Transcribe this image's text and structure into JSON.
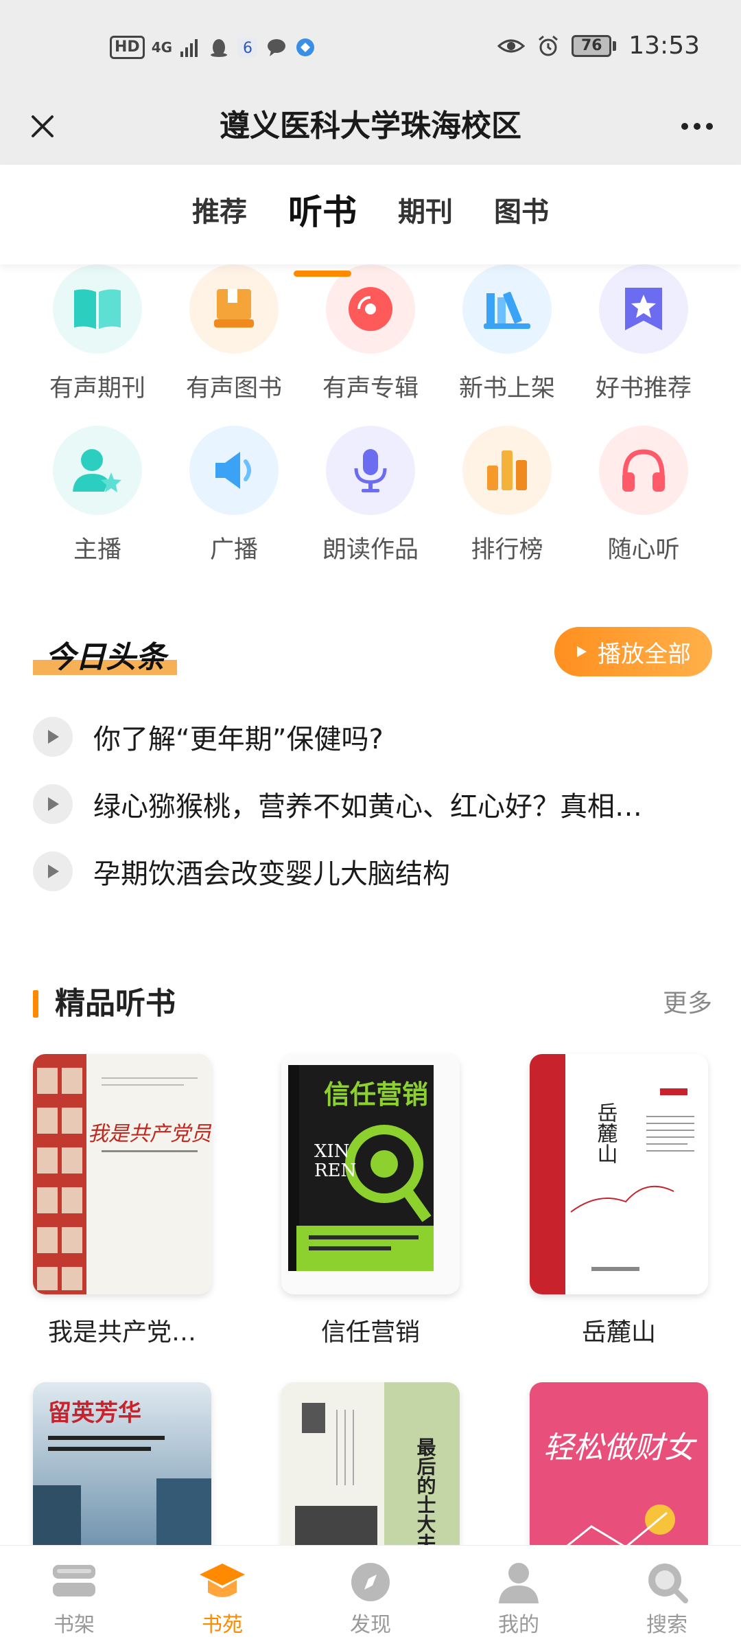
{
  "status": {
    "left_badge": "HD",
    "network": "4G",
    "battery": "76",
    "time": "13:53"
  },
  "navbar": {
    "title": "遵义医科大学珠海校区"
  },
  "tabs": [
    {
      "label": "推荐"
    },
    {
      "label": "听书"
    },
    {
      "label": "期刊"
    },
    {
      "label": "图书"
    }
  ],
  "categories": [
    {
      "label": "有声期刊",
      "icon": "book-open-icon",
      "color": "#2ccfbf"
    },
    {
      "label": "有声图书",
      "icon": "book-stack-icon",
      "color": "#f5a43a"
    },
    {
      "label": "有声专辑",
      "icon": "disc-icon",
      "color": "#ff5a5a"
    },
    {
      "label": "新书上架",
      "icon": "bookshelf-icon",
      "color": "#3aa3f5"
    },
    {
      "label": "好书推荐",
      "icon": "star-bookmark-icon",
      "color": "#6b6cf0"
    },
    {
      "label": "主播",
      "icon": "host-icon",
      "color": "#2ccfbf"
    },
    {
      "label": "广播",
      "icon": "speaker-icon",
      "color": "#3aa3f5"
    },
    {
      "label": "朗读作品",
      "icon": "microphone-icon",
      "color": "#6b6cf0"
    },
    {
      "label": "排行榜",
      "icon": "bar-chart-icon",
      "color": "#f59a2a"
    },
    {
      "label": "随心听",
      "icon": "headphones-icon",
      "color": "#ff5a6a"
    }
  ],
  "headlines": {
    "title": "今日头条",
    "play_all": "播放全部",
    "items": [
      "你了解“更年期”保健吗?",
      "绿心猕猴桃，营养不如黄心、红心好？真相…",
      "孕期饮酒会改变婴儿大脑结构"
    ]
  },
  "featured": {
    "title": "精品听书",
    "more": "更多",
    "books": [
      {
        "title": "我是共产党…",
        "cover_text": "我是共产党员"
      },
      {
        "title": "信任营销",
        "cover_text": "信任营销"
      },
      {
        "title": "岳麓山",
        "cover_text": "岳麓山"
      },
      {
        "title": "",
        "cover_text": "留英芳华"
      },
      {
        "title": "",
        "cover_text": "最后的士大夫"
      },
      {
        "title": "",
        "cover_text": "轻松做财女"
      }
    ]
  },
  "bottom_nav": [
    {
      "label": "书架",
      "icon": "bookshelf-icon"
    },
    {
      "label": "书苑",
      "icon": "graduation-cap-icon"
    },
    {
      "label": "发现",
      "icon": "compass-icon"
    },
    {
      "label": "我的",
      "icon": "user-icon"
    },
    {
      "label": "搜索",
      "icon": "search-icon"
    }
  ],
  "colors": {
    "accent": "#ff8a00",
    "topbar": "#ededed"
  }
}
